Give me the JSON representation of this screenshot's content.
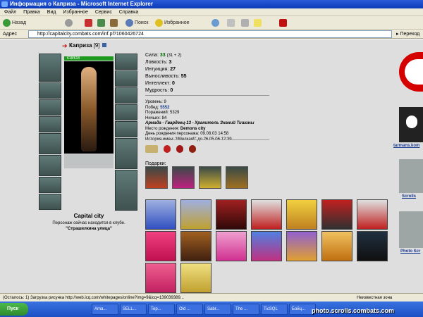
{
  "window": {
    "title": "Информация о Каприза - Microsoft Internet Explorer"
  },
  "menu": [
    "Файл",
    "Правка",
    "Вид",
    "Избранное",
    "Сервис",
    "Справка"
  ],
  "toolbar": {
    "back": "Назад",
    "search": "Поиск",
    "favorites": "Избранное"
  },
  "address": {
    "label": "Адрес",
    "url": "http://capitalcity.combats.com/inf.pl?1060426724",
    "go": "Переход"
  },
  "character": {
    "name": "Каприза",
    "level": "[9]",
    "hp": "618/618",
    "city": "Capital city",
    "club_text": "Персонаж сейчас находится в клубе.",
    "location": "\"Страшилкина улица\""
  },
  "stats": [
    {
      "label": "Сила:",
      "value": "33",
      "extra": "(31 + 2)"
    },
    {
      "label": "Ловкость:",
      "value": "3",
      "extra": ""
    },
    {
      "label": "Интуиция:",
      "value": "27",
      "extra": ""
    },
    {
      "label": "Выносливость:",
      "value": "55",
      "extra": ""
    },
    {
      "label": "Интеллект:",
      "value": "0",
      "extra": ""
    },
    {
      "label": "Мудрость:",
      "value": "0",
      "extra": ""
    }
  ],
  "bio": {
    "level": "Уровень: 9",
    "wins_label": "Побед:",
    "wins": "5552",
    "losses": "Поражений: 5329",
    "draws": "Ничьих: 84",
    "army": "Армада - Гвардеец-13 - Хранитель Знаний Тишины",
    "birthplace_label": "Место рождения:",
    "birthplace": "Demons city",
    "birthday": "День рождения персонажа: 09.08.03 14:58",
    "names_history": "История имен: '!!Мелкая!!' до 26.05.06 12:39"
  },
  "gifts_label": "Подарки:",
  "sidebar": {
    "link1": "tarmans.kom",
    "link2": "Scrolls",
    "link3": "Photo Scr"
  },
  "statusbar": {
    "text": "(Осталось: 1) Загрузка рисунка http://web.icq.com/whitepages/online?img=9&icq=139039389...",
    "zone": "Неизвестная зона"
  },
  "taskbar": {
    "start": "Пуск",
    "tasks": [
      "Ama...",
      "SELL...",
      "Tep...",
      "Old ...",
      "Sabr...",
      "The ...",
      "TicSQL",
      "Бойц..."
    ],
    "tray_text": "photo.scrolls.combats.com"
  },
  "colors": {
    "accent": "#0a3ab8",
    "content_bg": "#dedede",
    "hp": "#1d9a1d"
  }
}
